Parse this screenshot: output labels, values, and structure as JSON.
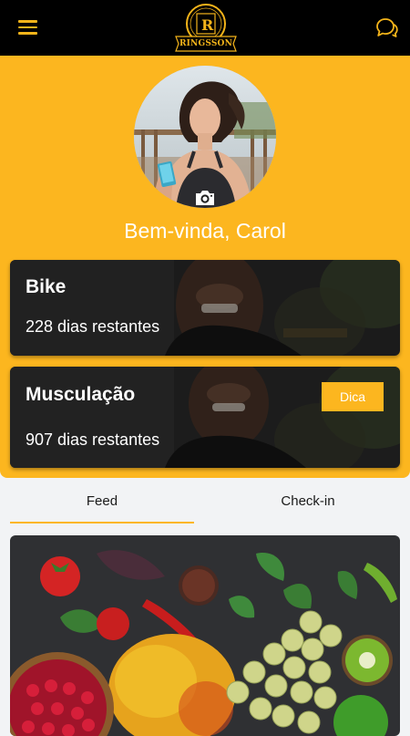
{
  "header": {
    "logo_text": "RINGSSON",
    "menu_icon": "hamburger-menu-icon",
    "chat_icon": "chat-bubbles-icon",
    "accent_color": "#fcb61f"
  },
  "profile": {
    "greeting": "Bem-vinda, Carol",
    "camera_icon": "camera-icon"
  },
  "plans": [
    {
      "title": "Bike",
      "remaining": "228 dias restantes"
    },
    {
      "title": "Musculação",
      "remaining": "907 dias restantes",
      "button_label": "Dica"
    }
  ],
  "tabs": [
    {
      "label": "Feed",
      "active": true
    },
    {
      "label": "Check-in",
      "active": false
    }
  ]
}
